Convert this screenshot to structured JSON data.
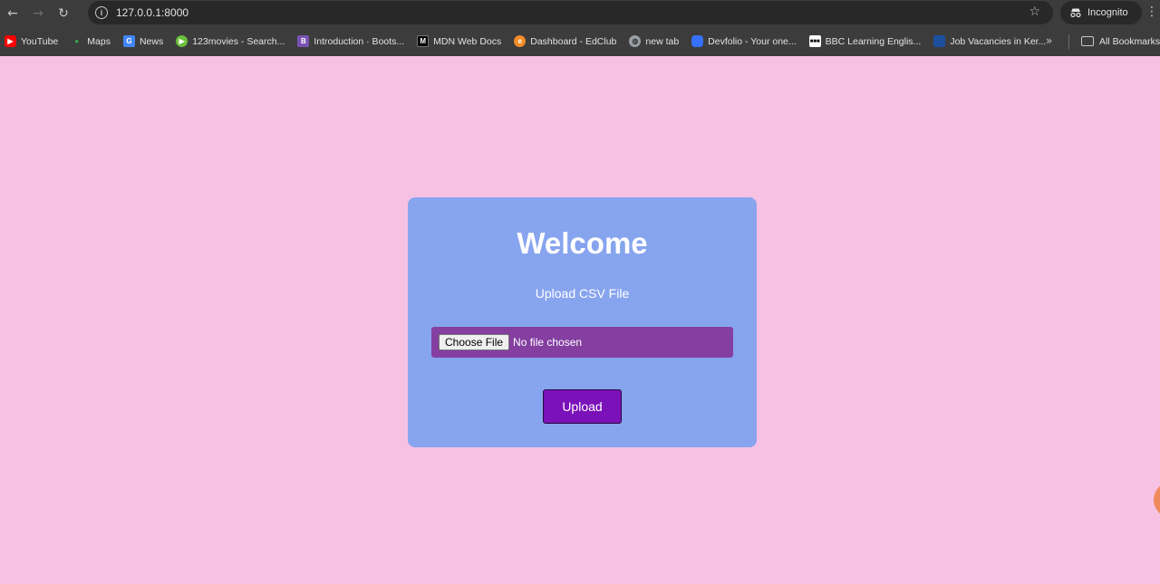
{
  "browser": {
    "url": "127.0.0.1:8000",
    "profile_label": "Incognito",
    "nav": {
      "back": "←",
      "forward": "→",
      "reload": "↻",
      "star": "☆",
      "menu": "⋮"
    },
    "bookmarks": [
      {
        "label": "YouTube",
        "icon": "youtube-icon",
        "color": "#ff0000"
      },
      {
        "label": "Maps",
        "icon": "maps-icon",
        "color": "#34a853"
      },
      {
        "label": "News",
        "icon": "news-icon",
        "color": "#4285f4"
      },
      {
        "label": "123movies - Search...",
        "icon": "play-icon",
        "color": "#6abf3a"
      },
      {
        "label": "Introduction · Boots...",
        "icon": "bootstrap-icon",
        "color": "#7952b3"
      },
      {
        "label": "MDN Web Docs",
        "icon": "mdn-icon",
        "color": "#000000"
      },
      {
        "label": "Dashboard - EdClub",
        "icon": "edclub-icon",
        "color": "#f28c28"
      },
      {
        "label": "new tab",
        "icon": "globe-icon",
        "color": "#9aa0a6"
      },
      {
        "label": "Devfolio - Your one...",
        "icon": "devfolio-icon",
        "color": "#3770ff"
      },
      {
        "label": "BBC Learning Englis...",
        "icon": "bbc-icon",
        "color": "#ffffff"
      },
      {
        "label": "Job Vacancies in Ker...",
        "icon": "jobs-icon",
        "color": "#1c4f9c"
      }
    ],
    "more_bookmarks": "»",
    "all_bookmarks": "All Bookmarks"
  },
  "page": {
    "title": "Welcome",
    "subtitle": "Upload CSV File",
    "file_input": {
      "button_label": "Choose File",
      "status": "No file chosen"
    },
    "upload_label": "Upload"
  }
}
